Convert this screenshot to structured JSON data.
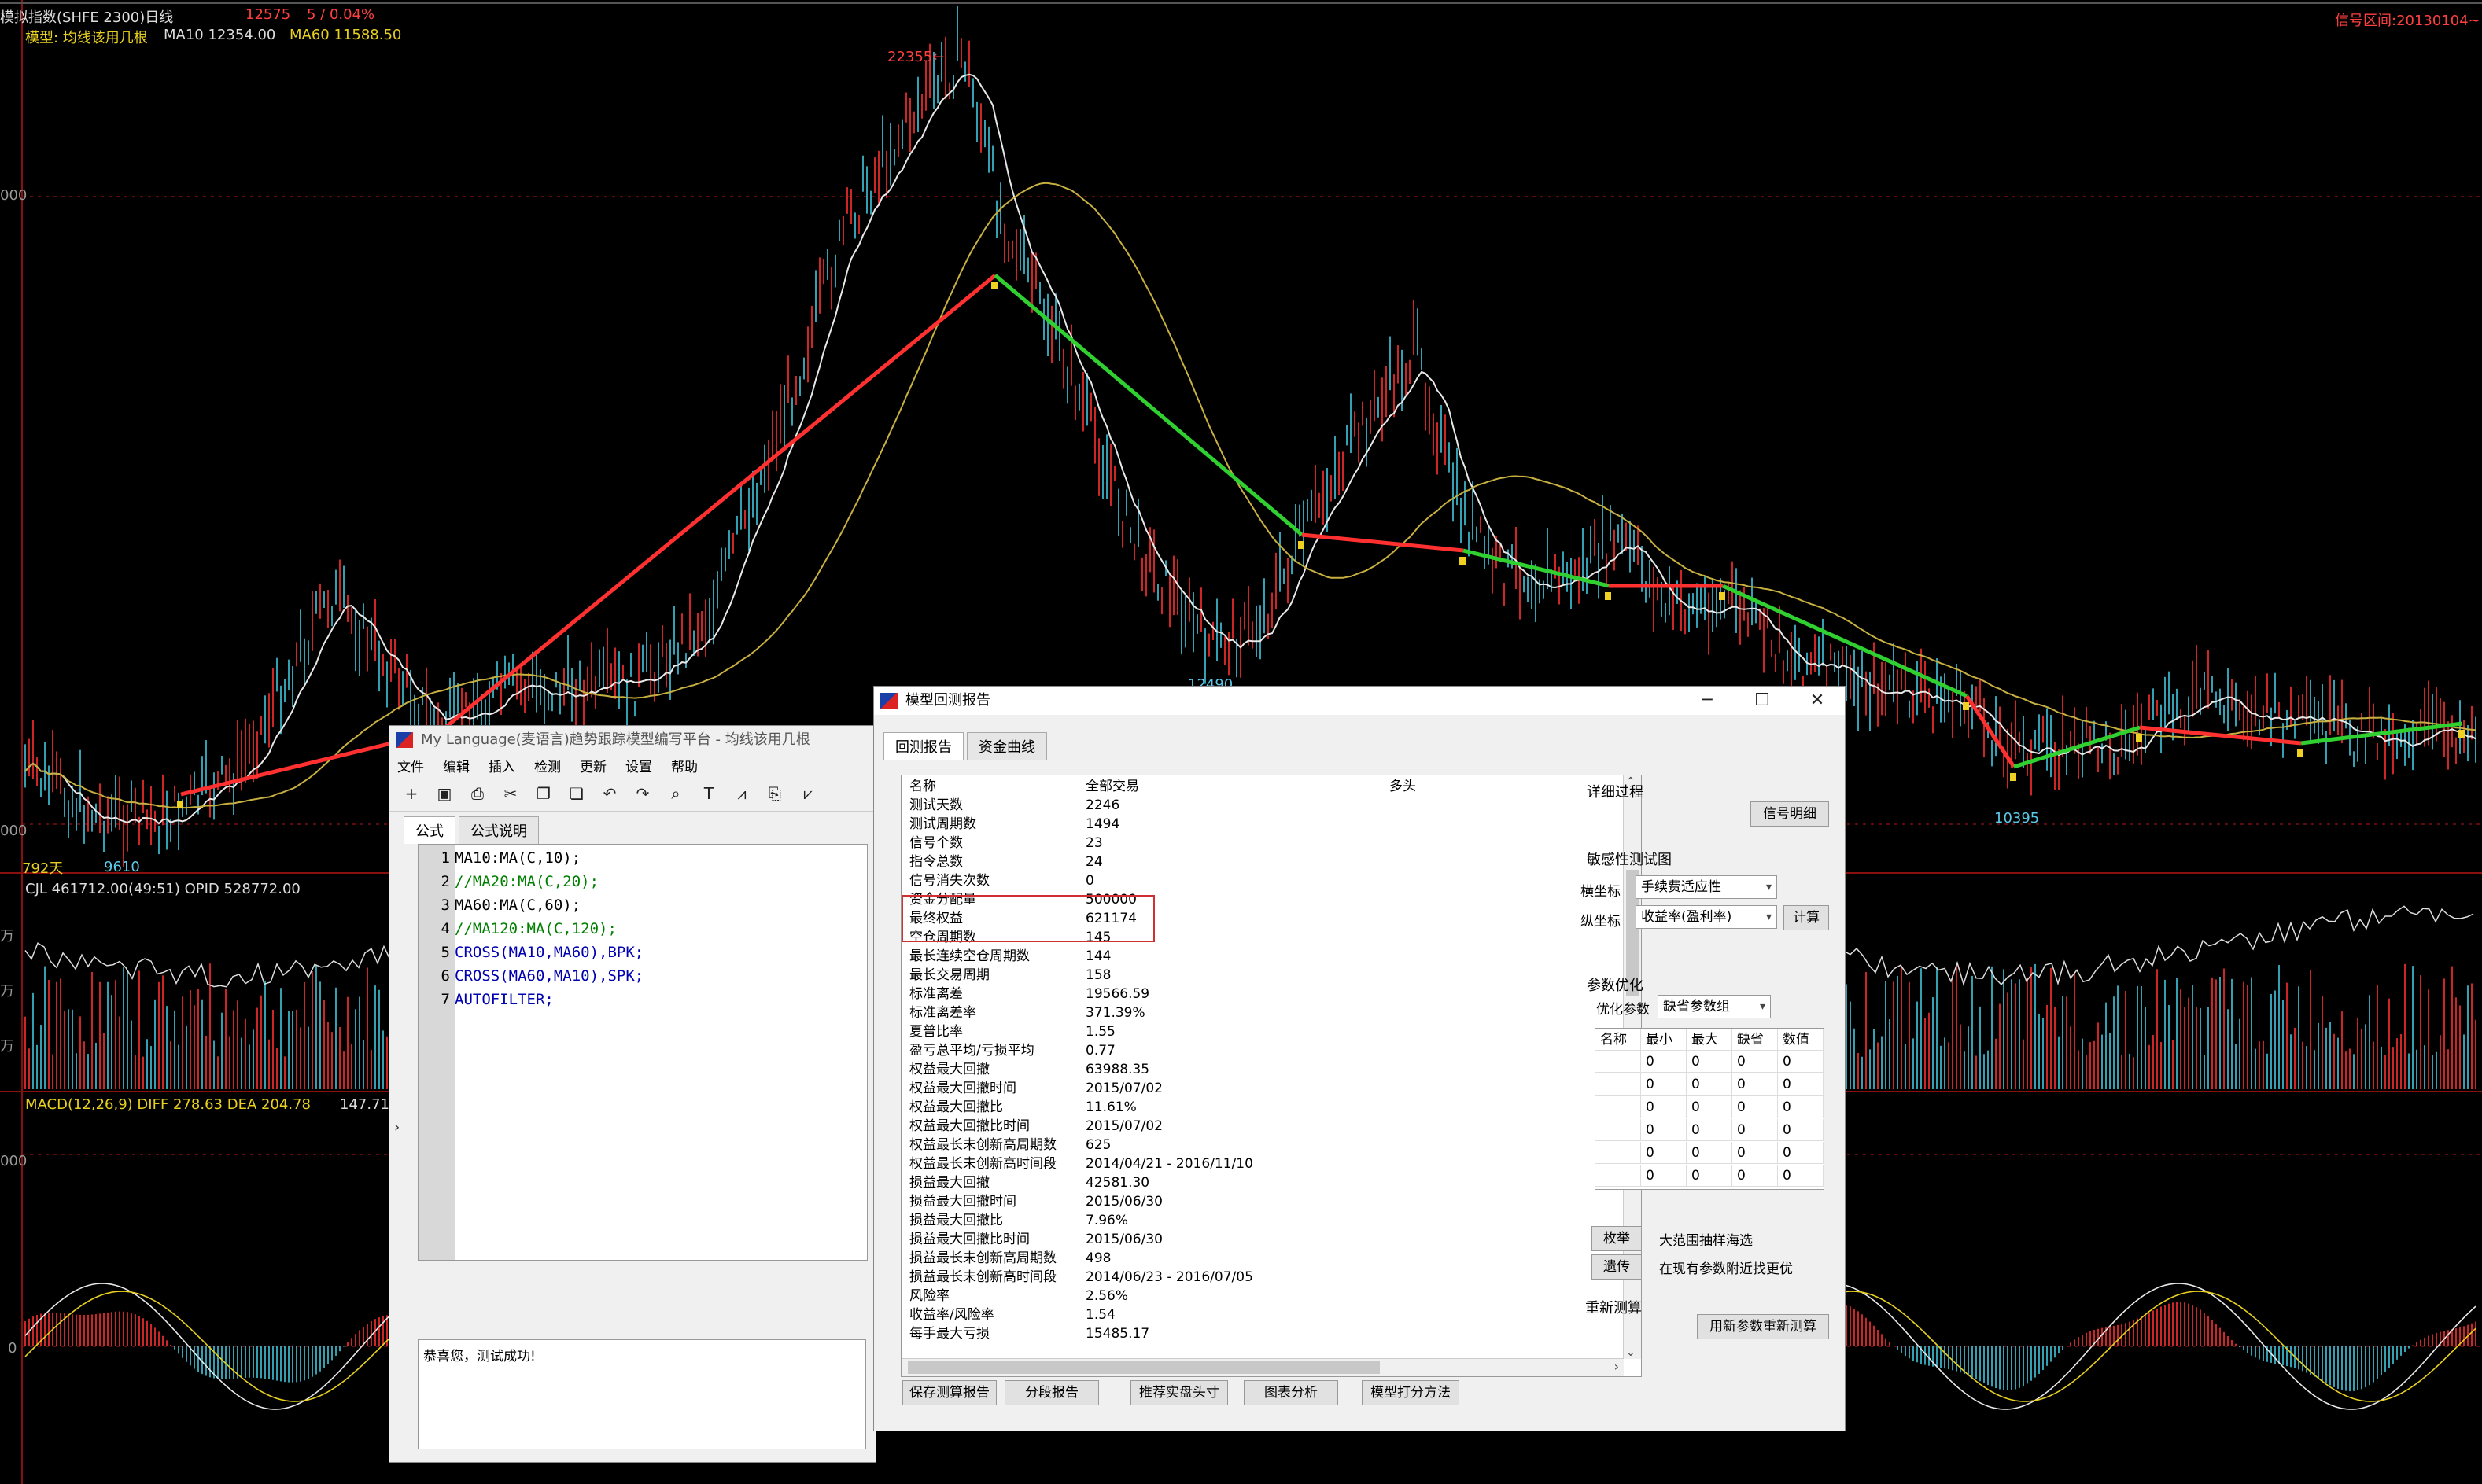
{
  "header": {
    "title": "模拟指数(SHFE 2300)日线",
    "price": "12575",
    "change": "5 / 0.04%",
    "model_line": "模型: 均线该用几根",
    "ma10": "MA10 12354.00",
    "ma60": "MA60 11588.50",
    "signal_range": "信号区间:20130104~"
  },
  "chart_labels": {
    "peak": "22355←",
    "low1": "12490",
    "low2": "10395",
    "low3": "9610",
    "days": "792天",
    "cjl": "CJL  461712.00(49:51)  OPID 528772.00",
    "macd": "MACD(12,26,9)  DIFF 278.63   DEA 204.78",
    "macd_val": "147.71",
    "yaxis_000a": "000",
    "yaxis_000b": "000",
    "yaxis_000c": "000",
    "yaxis_wan1": "万",
    "yaxis_wan2": "万",
    "yaxis_wan3": "万",
    "yaxis_zero": "0"
  },
  "editor": {
    "title": "My Language(麦语言)趋势跟踪模型编写平台 - 均线该用几根",
    "menu": [
      "文件",
      "编辑",
      "插入",
      "检测",
      "更新",
      "设置",
      "帮助"
    ],
    "toolbar_icons": [
      "new-icon",
      "save-icon",
      "print-icon",
      "cut-icon",
      "copy-icon",
      "paste-icon",
      "undo-icon",
      "redo-icon",
      "find-icon",
      "text-icon",
      "chart-icon",
      "export-icon",
      "signal-icon"
    ],
    "toolbar_glyphs": [
      "+",
      "▣",
      "⎙",
      "✂",
      "❐",
      "❏",
      "↶",
      "↷",
      "⌕",
      "T",
      "⩘",
      "⎘",
      "⩗"
    ],
    "tabs": [
      "公式",
      "公式说明"
    ],
    "code": [
      {
        "n": "1",
        "t": "MA10:MA(C,10);"
      },
      {
        "n": "2",
        "t": "//MA20:MA(C,20);"
      },
      {
        "n": "3",
        "t": "MA60:MA(C,60);"
      },
      {
        "n": "4",
        "t": "//MA120:MA(C,120);"
      },
      {
        "n": "5",
        "t": "CROSS(MA10,MA60),BPK;"
      },
      {
        "n": "6",
        "t": "CROSS(MA60,MA10),SPK;"
      },
      {
        "n": "7",
        "t": "AUTOFILTER;"
      }
    ],
    "message": "恭喜您，测试成功!"
  },
  "report": {
    "title": "模型回测报告",
    "controls": [
      "─",
      "☐",
      "✕"
    ],
    "tabs": [
      "回测报告",
      "资金曲线"
    ],
    "columns": [
      "名称",
      "全部交易",
      "多头"
    ],
    "rows": [
      [
        "测试天数",
        "2246"
      ],
      [
        "测试周期数",
        "1494"
      ],
      [
        "信号个数",
        "23"
      ],
      [
        "指令总数",
        "24"
      ],
      [
        "信号消失次数",
        "0"
      ],
      [
        "资金分配量",
        "500000"
      ],
      [
        "最终权益",
        "621174"
      ],
      [
        "空仓周期数",
        "145"
      ],
      [
        "最长连续空仓周期数",
        "144"
      ],
      [
        "最长交易周期",
        "158"
      ],
      [
        "标准离差",
        "19566.59"
      ],
      [
        "标准离差率",
        "371.39%"
      ],
      [
        "夏普比率",
        "1.55"
      ],
      [
        "盈亏总平均/亏损平均",
        "0.77"
      ],
      [
        "权益最大回撤",
        "63988.35"
      ],
      [
        "权益最大回撤时间",
        "2015/07/02"
      ],
      [
        "权益最大回撤比",
        "11.61%"
      ],
      [
        "权益最大回撤比时间",
        "2015/07/02"
      ],
      [
        "权益最长未创新高周期数",
        "625"
      ],
      [
        "权益最长未创新高时间段",
        "2014/04/21 - 2016/11/10"
      ],
      [
        "损益最大回撤",
        "42581.30"
      ],
      [
        "损益最大回撤时间",
        "2015/06/30"
      ],
      [
        "损益最大回撤比",
        "7.96%"
      ],
      [
        "损益最大回撤比时间",
        "2015/06/30"
      ],
      [
        "损益最长未创新高周期数",
        "498"
      ],
      [
        "损益最长未创新高时间段",
        "2014/06/23 - 2016/07/05"
      ],
      [
        "风险率",
        "2.56%"
      ],
      [
        "收益率/风险率",
        "1.54"
      ],
      [
        "每手最大亏损",
        "15485.17"
      ]
    ],
    "bottom_buttons": [
      "保存测算报告",
      "分段报告",
      "推荐实盘头寸",
      "图表分析",
      "模型打分方法"
    ],
    "detail": {
      "label": "详细过程",
      "button": "信号明细"
    },
    "sensitivity": {
      "label": "敏感性测试图",
      "x_label": "横坐标",
      "x_value": "手续费适应性",
      "y_label": "纵坐标",
      "y_value": "收益率(盈利率)",
      "calc_button": "计算"
    },
    "optimize": {
      "label": "参数优化",
      "param_label": "优化参数",
      "param_value": "缺省参数组",
      "headers": [
        "名称",
        "最小",
        "最大",
        "缺省",
        "数值"
      ],
      "rows": [
        [
          "",
          "0",
          "0",
          "0",
          "0"
        ],
        [
          "",
          "0",
          "0",
          "0",
          "0"
        ],
        [
          "",
          "0",
          "0",
          "0",
          "0"
        ],
        [
          "",
          "0",
          "0",
          "0",
          "0"
        ],
        [
          "",
          "0",
          "0",
          "0",
          "0"
        ],
        [
          "",
          "0",
          "0",
          "0",
          "0"
        ]
      ],
      "enum_button": "枚举",
      "enum_desc": "大范围抽样海选",
      "genetic_button": "遗传",
      "genetic_desc": "在现有参数附近找更优"
    },
    "recalc": {
      "label": "重新测算",
      "button": "用新参数重新测算"
    }
  }
}
